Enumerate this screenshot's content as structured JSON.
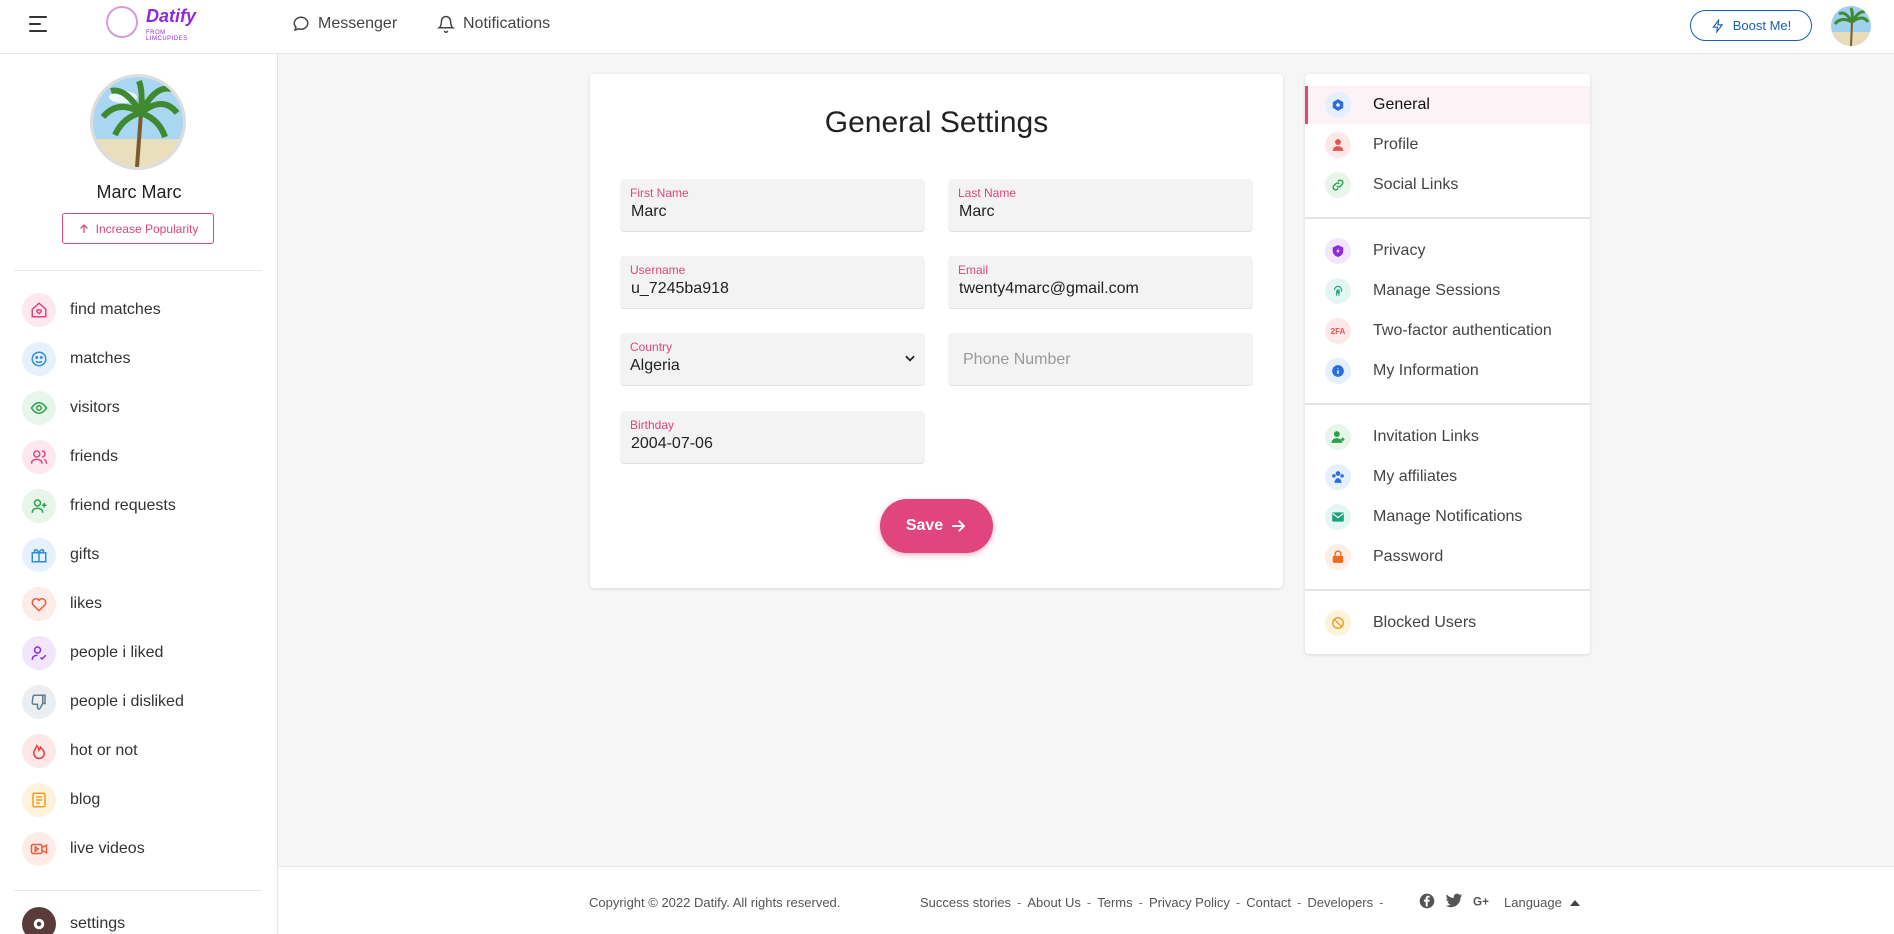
{
  "header": {
    "logo_text": "Datify",
    "logo_subtext": "FROM LIMCUPIDES",
    "nav": [
      {
        "label": "Messenger"
      },
      {
        "label": "Notifications"
      }
    ],
    "boost_label": "Boost Me!"
  },
  "profile": {
    "name": "Marc Marc",
    "popularity_label": "Increase Popularity"
  },
  "sidebar": {
    "items": [
      {
        "label": "find matches",
        "icon": "home-heart-icon",
        "color": "#e0457b"
      },
      {
        "label": "matches",
        "icon": "smile-icon",
        "color": "#2a8fe0"
      },
      {
        "label": "visitors",
        "icon": "eye-icon",
        "color": "#27a14a"
      },
      {
        "label": "friends",
        "icon": "users-icon",
        "color": "#e0457b"
      },
      {
        "label": "friend requests",
        "icon": "user-plus-icon",
        "color": "#27a14a"
      },
      {
        "label": "gifts",
        "icon": "gift-icon",
        "color": "#2a8fe0"
      },
      {
        "label": "likes",
        "icon": "heart-icon",
        "color": "#f05a3a"
      },
      {
        "label": "people i liked",
        "icon": "user-check-icon",
        "color": "#8e2ad8"
      },
      {
        "label": "people i disliked",
        "icon": "thumbs-down-icon",
        "color": "#607d8b"
      },
      {
        "label": "hot or not",
        "icon": "flame-icon",
        "color": "#f03a3a"
      },
      {
        "label": "blog",
        "icon": "document-icon",
        "color": "#f0a020"
      },
      {
        "label": "live videos",
        "icon": "video-icon",
        "color": "#f05a3a"
      }
    ],
    "settings_label": "settings"
  },
  "settings_form": {
    "title": "General Settings",
    "first_name": {
      "label": "First Name",
      "value": "Marc"
    },
    "last_name": {
      "label": "Last Name",
      "value": "Marc"
    },
    "username": {
      "label": "Username",
      "value": "u_7245ba918"
    },
    "email": {
      "label": "Email",
      "value": "twenty4marc@gmail.com"
    },
    "country": {
      "label": "Country",
      "value": "Algeria"
    },
    "phone": {
      "placeholder": "Phone Number"
    },
    "birthday": {
      "label": "Birthday",
      "value": "2004-07-06"
    },
    "save_label": "Save"
  },
  "settings_menu": {
    "groups": [
      [
        {
          "label": "General",
          "icon": "hexagon-icon",
          "bg": "#e6f0fd",
          "color": "#2a6fe0",
          "active": true
        },
        {
          "label": "Profile",
          "icon": "user-icon",
          "bg": "#fde8e8",
          "color": "#e55353"
        },
        {
          "label": "Social Links",
          "icon": "link-icon",
          "bg": "#e7f5ea",
          "color": "#27a14a"
        }
      ],
      [
        {
          "label": "Privacy",
          "icon": "shield-icon",
          "bg": "#f1e6fb",
          "color": "#8e2ad8"
        },
        {
          "label": "Manage Sessions",
          "icon": "fingerprint-icon",
          "bg": "#e3f6f1",
          "color": "#1aa37a"
        },
        {
          "label": "Two-factor authentication",
          "icon": "two-factor-icon",
          "bg": "#fde8e8",
          "color": "#e55353",
          "icon_text": "2FA"
        },
        {
          "label": "My Information",
          "icon": "info-icon",
          "bg": "#e6f0fd",
          "color": "#2a6fe0"
        }
      ],
      [
        {
          "label": "Invitation Links",
          "icon": "user-plus-icon",
          "bg": "#e7f5ea",
          "color": "#27a14a"
        },
        {
          "label": "My affiliates",
          "icon": "affiliates-icon",
          "bg": "#e6f0fd",
          "color": "#2a6fe0"
        },
        {
          "label": "Manage Notifications",
          "icon": "mail-icon",
          "bg": "#e3f6f1",
          "color": "#1aa37a"
        },
        {
          "label": "Password",
          "icon": "lock-icon",
          "bg": "#fdeee6",
          "color": "#f06a20"
        }
      ],
      [
        {
          "label": "Blocked Users",
          "icon": "block-icon",
          "bg": "#fdf3dc",
          "color": "#f0a020"
        }
      ]
    ]
  },
  "footer": {
    "copyright": "Copyright © 2022 Datify. All rights reserved.",
    "links": [
      "Success stories",
      "About Us",
      "Terms",
      "Privacy Policy",
      "Contact",
      "Developers"
    ],
    "separator": "-",
    "language_label": "Language"
  },
  "colors": {
    "accent": "#e0457b",
    "boost": "#1a5fb4"
  }
}
